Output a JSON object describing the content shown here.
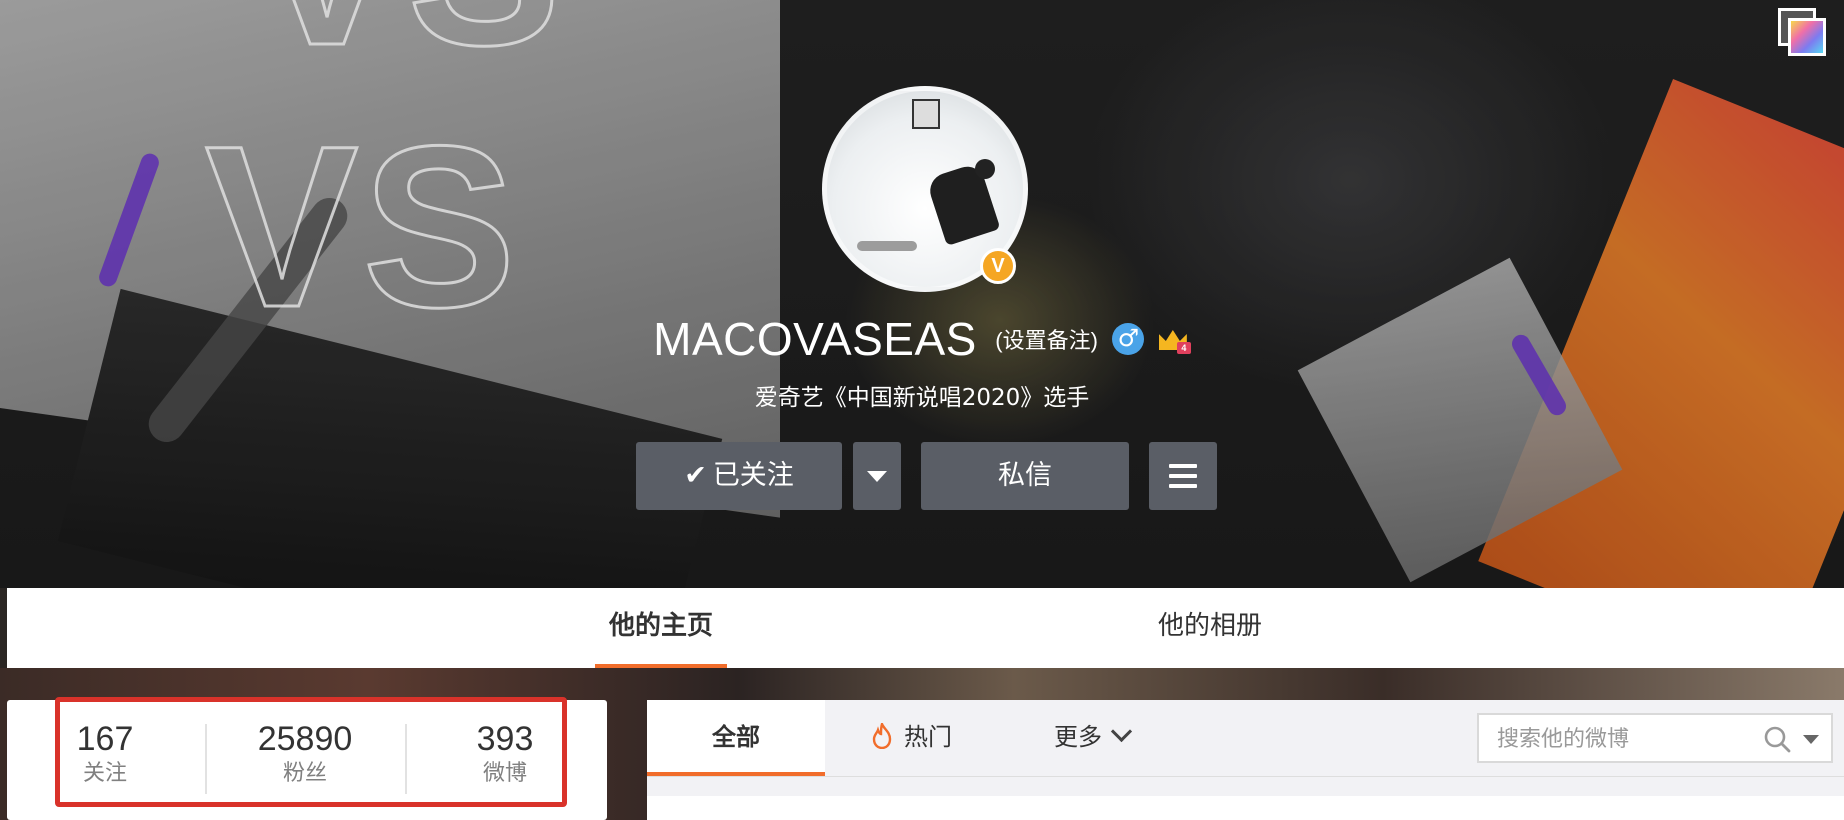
{
  "profile": {
    "name": "MACOVASEAS",
    "remark_link": "(设置备注)",
    "bio": "爱奇艺《中国新说唱2020》选手",
    "verify_badge": "V",
    "gender_icon": "♂",
    "vip_tag": "4"
  },
  "cover": {
    "watermark_text": "VS"
  },
  "actions": {
    "follow_label": "已关注",
    "follow_check": "✔",
    "message_label": "私信"
  },
  "nav_tabs": [
    {
      "label": "他的主页",
      "active": true
    },
    {
      "label": "他的相册",
      "active": false
    }
  ],
  "stats": [
    {
      "value": "167",
      "label": "关注"
    },
    {
      "value": "25890",
      "label": "粉丝"
    },
    {
      "value": "393",
      "label": "微博"
    }
  ],
  "feed_tabs": {
    "all": "全部",
    "hot": "热门",
    "more": "更多"
  },
  "search": {
    "placeholder": "搜索他的微博"
  },
  "colors": {
    "accent": "#f16d2b",
    "highlight_box": "#d9322a",
    "button_bg": "#5a5e66",
    "verify_badge": "#f5a623",
    "gender_icon": "#4aa3e8"
  }
}
